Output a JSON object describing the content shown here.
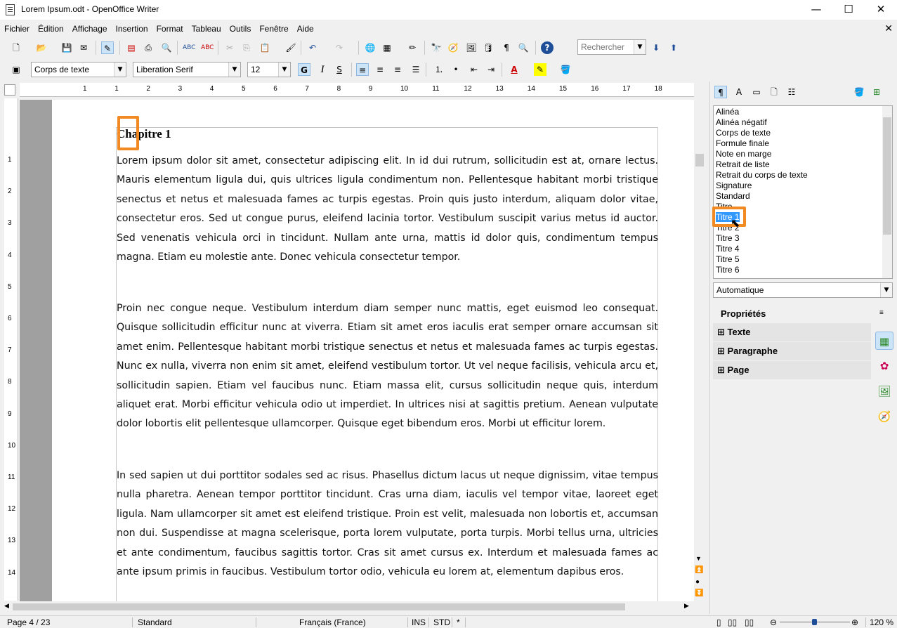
{
  "window": {
    "title": "Lorem Ipsum.odt - OpenOffice Writer",
    "minimize": "—",
    "maximize": "☐",
    "close": "✕"
  },
  "menu": [
    "Fichier",
    "Édition",
    "Affichage",
    "Insertion",
    "Format",
    "Tableau",
    "Outils",
    "Fenêtre",
    "Aide"
  ],
  "menu_close": "✕",
  "toolbar": {
    "search_placeholder": "Rechercher"
  },
  "formatting": {
    "paragraph_style": "Corps de texte",
    "font_name": "Liberation Serif",
    "font_size": "12",
    "bold": "G",
    "italic": "I",
    "underline": "S"
  },
  "ruler": {
    "h_ticks": [
      "1",
      "1",
      "2",
      "3",
      "4",
      "5",
      "6",
      "7",
      "8",
      "9",
      "10",
      "11",
      "12",
      "13",
      "14",
      "15",
      "16",
      "17",
      "18"
    ],
    "v_ticks": [
      "1",
      "2",
      "3",
      "4",
      "5",
      "6",
      "7",
      "8",
      "9",
      "10",
      "11",
      "12",
      "13",
      "14"
    ]
  },
  "document": {
    "heading": "Chapitre 1",
    "paragraphs": [
      "Lorem ipsum dolor sit amet, consectetur adipiscing elit. In id dui rutrum, sollicitudin est at, ornare lectus. Mauris elementum ligula dui, quis ultrices ligula condimentum non. Pellentesque habitant morbi tristique senectus et netus et malesuada fames ac turpis egestas. Proin quis justo interdum, aliquam dolor vitae, consectetur eros. Sed ut congue purus, eleifend lacinia tortor. Vestibulum suscipit varius metus id auctor. Sed venenatis vehicula orci in tincidunt. Nullam ante urna, mattis id dolor quis, condimentum tempus magna. Etiam eu molestie ante. Donec vehicula consectetur tempor.",
      "Proin nec congue neque. Vestibulum interdum diam semper nunc mattis, eget euismod leo consequat. Quisque sollicitudin efficitur nunc at viverra. Etiam sit amet eros iaculis erat semper ornare accumsan sit amet enim. Pellentesque habitant morbi tristique senectus et netus et malesuada fames ac turpis egestas. Nunc ex nulla, viverra non enim sit amet, eleifend vestibulum tortor. Ut vel neque facilisis, vehicula arcu et, sollicitudin sapien. Etiam vel faucibus nunc. Etiam massa elit, cursus sollicitudin neque quis, interdum aliquet erat. Morbi efficitur vehicula odio ut imperdiet. In ultrices nisi at sagittis pretium. Aenean vulputate dolor lobortis elit pellentesque ullamcorper. Quisque eget bibendum eros. Morbi ut efficitur lorem.",
      "In sed sapien ut dui porttitor sodales sed ac risus. Phasellus dictum lacus ut neque dignissim, vitae tempus nulla pharetra. Aenean tempor porttitor tincidunt. Cras urna diam, iaculis vel tempor vitae, laoreet eget ligula. Nam ullamcorper sit amet est eleifend tristique. Proin est velit, malesuada non lobortis et, accumsan non dui. Suspendisse at magna scelerisque, porta lorem vulputate, porta turpis. Morbi tellus urna, ultricies et ante condimentum, faucibus sagittis tortor. Cras sit amet cursus ex. Interdum et malesuada fames ac ante ipsum primis in faucibus. Vestibulum tortor odio, vehicula eu lorem at, elementum dapibus eros."
    ]
  },
  "styles_panel": {
    "items": [
      "Alinéa",
      "Alinéa négatif",
      "Corps de texte",
      "Formule finale",
      "Note en marge",
      "Retrait de liste",
      "Retrait du corps de texte",
      "Signature",
      "Standard",
      "Titre",
      "Titre 1",
      "Titre 2",
      "Titre 3",
      "Titre 4",
      "Titre 5",
      "Titre 6"
    ],
    "selected": "Titre 1",
    "filter": "Automatique"
  },
  "properties": {
    "header": "Propriétés",
    "sections": [
      "Texte",
      "Paragraphe",
      "Page"
    ]
  },
  "status": {
    "page": "Page 4 / 23",
    "page_style": "Standard",
    "language": "Français (France)",
    "insert_mode": "INS",
    "selection_mode": "STD",
    "modified": "*",
    "zoom": "120 %"
  },
  "accent": "#f18a22"
}
